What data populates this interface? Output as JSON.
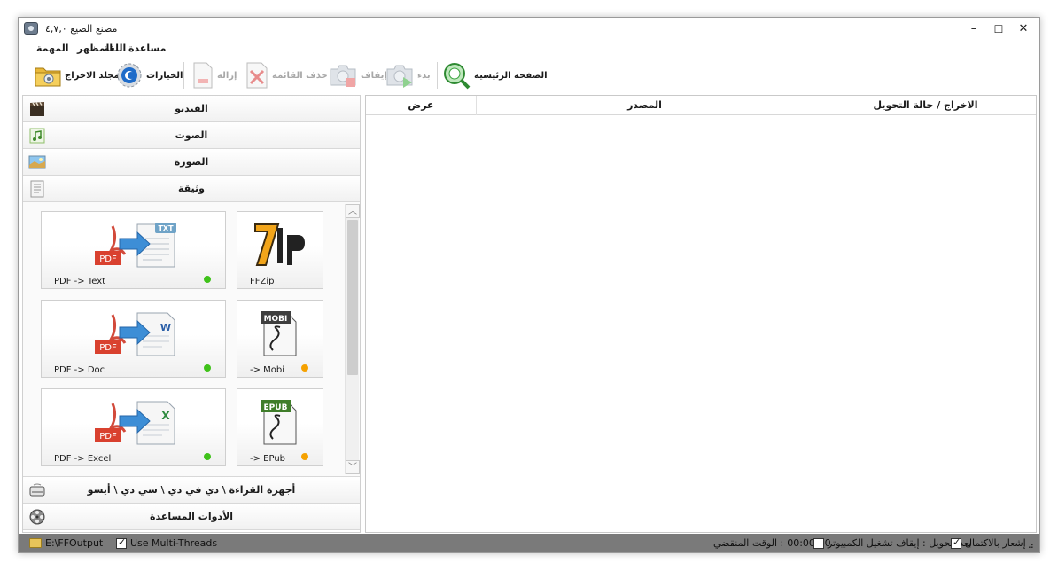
{
  "window": {
    "title": "مصنع الصيغ ٤,٧,٠",
    "minimize": "–",
    "maximize": "☐",
    "close": "✕"
  },
  "menu": [
    "المهمة",
    "المظهر",
    "اللغة",
    "مساعدة"
  ],
  "toolbar": {
    "output_folder": "مجلد الاخراج",
    "options": "الخيارات",
    "remove": "إزالة",
    "clear_list": "حذف القائمة",
    "stop": "إيقاف",
    "start": "بدء",
    "home": "الصفحة الرئيسية"
  },
  "categories": {
    "video": "الفيديو",
    "audio": "الصوت",
    "picture": "الصورة",
    "document": "وثيقة",
    "rom": "أجهزة القراءة \\ دي في دي \\ سي دي \\ أيسو",
    "utilities": "الأدوات المساعدة"
  },
  "tiles": [
    {
      "label": "PDF -> Text",
      "badge": "TXT",
      "status_color": "#3fc21a"
    },
    {
      "label": "FFZip",
      "status_color": ""
    },
    {
      "label": "PDF -> Doc",
      "badge": "W",
      "status_color": "#3fc21a"
    },
    {
      "label": "-> Mobi",
      "badge": "MOBI",
      "status_color": "#f5a100"
    },
    {
      "label": "PDF -> Excel",
      "badge": "X",
      "status_color": "#3fc21a"
    },
    {
      "label": "-> EPub",
      "badge": "EPUB",
      "status_color": "#f5a100"
    }
  ],
  "table": {
    "columns": [
      "عرض",
      "المصدر",
      "الاخراج / حالة التحويل"
    ]
  },
  "statusbar": {
    "output_path": "E:\\FFOutput",
    "multithreads_label": "Use Multi-Threads",
    "multithreads_checked": true,
    "elapsed_label": "الوقت المنقضي :",
    "elapsed_value": "00:00:00",
    "after_convert": "بعدالتحويل : إيقاف تشغيل الكمبيوتر",
    "after_convert_checked": false,
    "notify": "إشعار بالاكتمال",
    "notify_checked": true
  }
}
